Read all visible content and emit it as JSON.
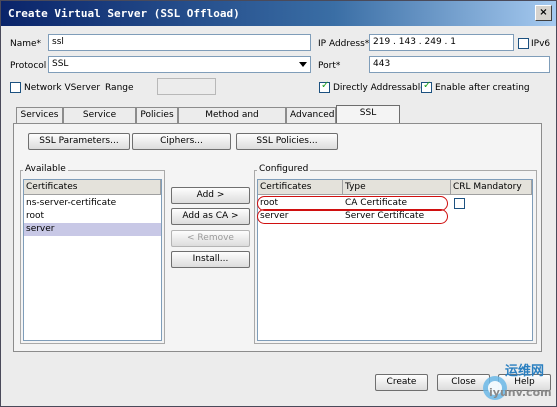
{
  "window": {
    "title": "Create Virtual Server (SSL Offload)",
    "close": "×"
  },
  "form": {
    "name_label": "Name*",
    "name_value": "ssl",
    "protocol_label": "Protocol",
    "protocol_value": "SSL",
    "network_vserver_label": "Network VServer",
    "range_label": "Range",
    "ip_label": "IP Address*",
    "ip_value": "219 . 143 . 249 . 1",
    "ipv6_label": "IPv6",
    "port_label": "Port*",
    "port_value": "443",
    "directly_addressable_label": "Directly Addressable",
    "enable_after_creating_label": "Enable after creating"
  },
  "tabs": [
    {
      "label": "Services"
    },
    {
      "label": "Service Groups"
    },
    {
      "label": "Policies"
    },
    {
      "label": "Method and Persistence"
    },
    {
      "label": "Advanced"
    },
    {
      "label": "SSL Settings"
    }
  ],
  "ssl_settings": {
    "buttons": {
      "ssl_parameters": "SSL Parameters...",
      "ciphers": "Ciphers...",
      "ssl_policies": "SSL Policies..."
    },
    "available": {
      "title": "Available",
      "header": "Certificates",
      "items": [
        "ns-server-certificate",
        "root",
        "server"
      ]
    },
    "actions": {
      "add": "Add >",
      "add_as_ca": "Add as CA >",
      "remove": "< Remove",
      "install": "Install..."
    },
    "configured": {
      "title": "Configured",
      "headers": [
        "Certificates",
        "Type",
        "CRL Mandatory"
      ],
      "rows": [
        {
          "certificate": "root",
          "type": "CA Certificate"
        },
        {
          "certificate": "server",
          "type": "Server Certificate"
        }
      ]
    }
  },
  "footer": {
    "create": "Create",
    "close": "Close",
    "help": "Help"
  },
  "watermark": {
    "text_cn": "运维网",
    "text_url": "iyunv.com"
  },
  "colors": {
    "title_start": "#0a246a",
    "title_end": "#a6caf0",
    "highlight_oval": "#d01010",
    "selection": "#c8c8e6"
  }
}
